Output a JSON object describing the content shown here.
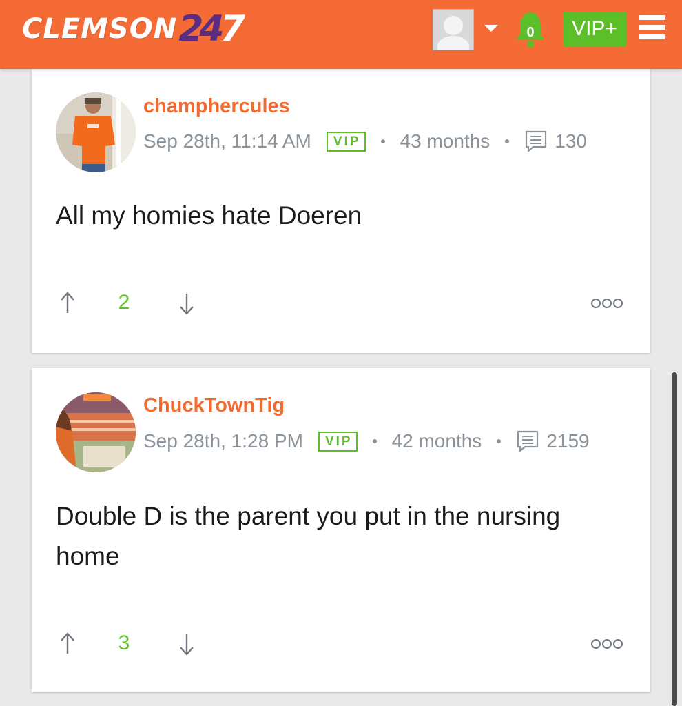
{
  "header": {
    "logo_school": "CLEMSON",
    "logo_num": [
      "2",
      "4",
      "7"
    ],
    "notification_count": "0",
    "vip_button_label": "VIP+",
    "brand_color": "#f56b36",
    "accent_green": "#5cbf2a"
  },
  "posts": [
    {
      "username": "champhercules",
      "timestamp": "Sep 28th, 11:14 AM",
      "badge": "VIP",
      "tenure": "43 months",
      "post_count": "130",
      "body": "All my homies hate Doeren",
      "score": "2",
      "avatar_icon": "user-photo-orange-shirt"
    },
    {
      "username": "ChuckTownTig",
      "timestamp": "Sep 28th, 1:28 PM",
      "badge": "VIP",
      "tenure": "42 months",
      "post_count": "2159",
      "body": "Double D is the parent you put in the nursing home",
      "score": "3",
      "avatar_icon": "user-photo-stadium"
    }
  ]
}
